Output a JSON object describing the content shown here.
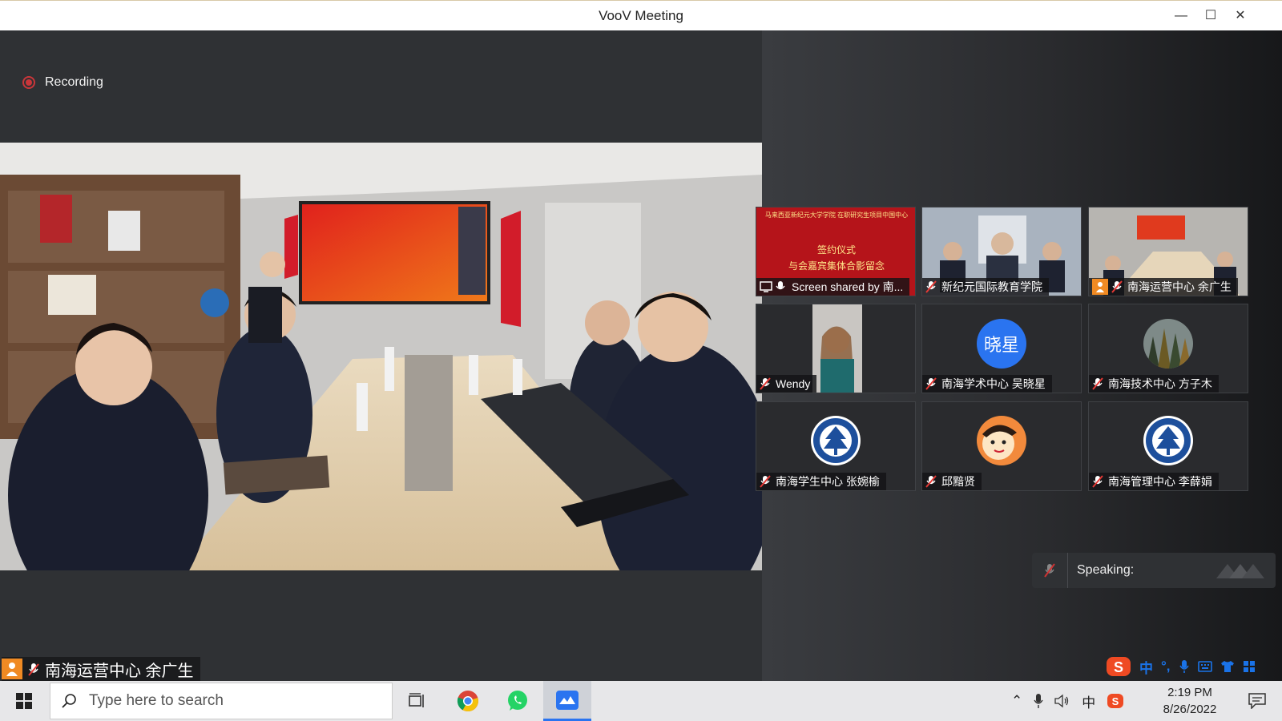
{
  "window": {
    "title": "VooV Meeting"
  },
  "recording": {
    "label": "Recording"
  },
  "main_speaker": {
    "name": "南海运营中心 余广生"
  },
  "participants": [
    {
      "label": "Screen shared by 南...",
      "kind": "screen",
      "bg": "#b5141a"
    },
    {
      "label": "新纪元国际教育学院",
      "kind": "room",
      "bg": "#7f8a98"
    },
    {
      "label": "南海运营中心 余广生",
      "kind": "room2",
      "bg": "#8b8880"
    },
    {
      "label": "Wendy",
      "kind": "person",
      "bg": "#2a2b2e"
    },
    {
      "label": "南海学术中心 吴晓星",
      "kind": "initials",
      "initials": "晓星",
      "bg": "#2a2b2e"
    },
    {
      "label": "南海技术中心 方子木",
      "kind": "forest",
      "bg": "#2a2b2e"
    },
    {
      "label": "南海学生中心 张婉榆",
      "kind": "logo",
      "bg": "#2a2b2e"
    },
    {
      "label": "邱黯贤",
      "kind": "cartoon",
      "bg": "#2a2b2e"
    },
    {
      "label": "南海管理中心 李薛娟",
      "kind": "logo",
      "bg": "#2a2b2e"
    }
  ],
  "screen_share_thumb": {
    "line1": "马来西亚新纪元大学学院 在职研究生项目中国中心",
    "line2": "签约仪式",
    "line3": "与会嘉宾集体合影留念"
  },
  "speaking": {
    "label": "Speaking:"
  },
  "taskbar": {
    "search_placeholder": "Type here to search",
    "time": "2:19 PM",
    "date": "8/26/2022",
    "ime_lang": "中",
    "ime_punct": "°,"
  },
  "colors": {
    "accent": "#2a74f0",
    "recording": "#c9363a",
    "brand_orange": "#f08a23"
  }
}
